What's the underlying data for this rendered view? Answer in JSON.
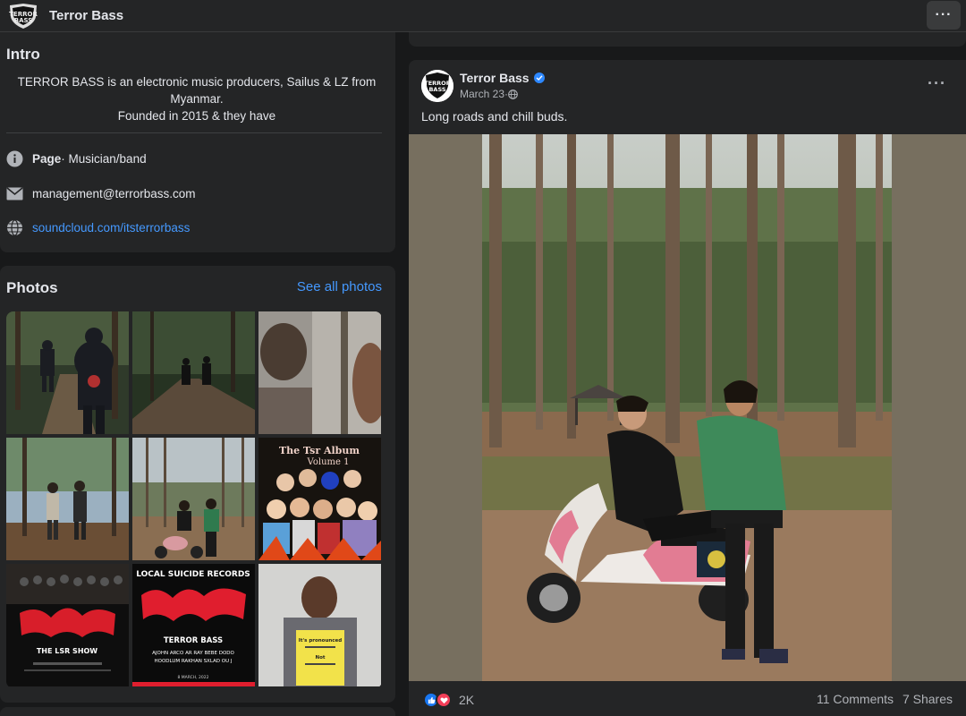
{
  "topbar": {
    "title": "Terror Bass",
    "more_label": "···",
    "logo_text": "TERROR BASS"
  },
  "intro": {
    "heading": "Intro",
    "bio_line1": "TERROR BASS is an electronic music producers, Sailus & LZ from",
    "bio_line2": "Myanmar.",
    "bio_line3": "Founded in 2015 & they have",
    "page_label": "Page",
    "page_category": " · Musician/band",
    "email": "management@terrorbass.com",
    "website": "soundcloud.com/itsterrorbass",
    "icons": [
      "info-icon",
      "email-icon",
      "globe-icon"
    ]
  },
  "photos": {
    "heading": "Photos",
    "see_all": "See all photos",
    "tiles": [
      {
        "name": "photo-forest-walk-1"
      },
      {
        "name": "photo-forest-boardwalk"
      },
      {
        "name": "photo-closeup-blur"
      },
      {
        "name": "photo-duo-standing-forest"
      },
      {
        "name": "photo-duo-scooter"
      },
      {
        "name": "photo-tsr-album-art",
        "title": "The Tsr Album",
        "subtitle": "Volume 1"
      },
      {
        "name": "photo-lsr-show",
        "text": "THE LSR SHOW"
      },
      {
        "name": "photo-local-suicide-records",
        "header": "LOCAL SUICIDE RECORDS",
        "line1": "TERROR BASS",
        "line2": "AJOHN  ARCO  AR RAY  BEBE  DODO",
        "line3": "HOODLUM  RAKHAN  SXLAD  OU J",
        "date": "8 MARCH, 2022"
      },
      {
        "name": "photo-person-sign",
        "sign1": "It's pronounced",
        "sign2": "Not"
      }
    ]
  },
  "post": {
    "author": "Terror Bass",
    "date": "March 23",
    "meta_sep": " · ",
    "caption": "Long roads and chill buds.",
    "more_label": "···",
    "reaction_count": "2K",
    "comments": "11 Comments",
    "shares": "7 Shares"
  },
  "colors": {
    "background": "#18191a",
    "card": "#242526",
    "link": "#4599ff",
    "like_blue": "#1877f2",
    "love_red": "#f33e58"
  }
}
